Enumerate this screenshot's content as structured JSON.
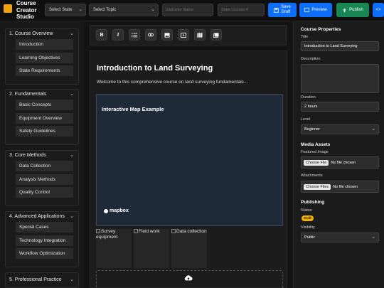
{
  "app": {
    "title_line1": "Course",
    "title_line2": "Creator",
    "title_line3": "Studio"
  },
  "topbar": {
    "state_select": "Select State",
    "topic_select": "Select Topic",
    "instructor_placeholder": "Instructor Name",
    "license_placeholder": "State License #",
    "save_label_line1": "Save",
    "save_label_line2": "Draft",
    "preview_label": "Preview",
    "publish_label": "Publish",
    "code_label": "<>"
  },
  "sidebar": {
    "sections": [
      {
        "title": "1. Course Overview",
        "items": [
          "Introduction",
          "Learning Objectives",
          "State Requirements"
        ]
      },
      {
        "title": "2. Fundamentals",
        "items": [
          "Basic Concepts",
          "Equipment Overview",
          "Safety Guidelines"
        ]
      },
      {
        "title": "3. Core Methods",
        "items": [
          "Data Collection",
          "Analysis Methods",
          "Quality Control"
        ]
      },
      {
        "title": "4. Advanced Applications",
        "items": [
          "Special Cases",
          "Technology Integration",
          "Workflow Optimization"
        ]
      },
      {
        "title": "5. Professional Practice",
        "items": []
      }
    ]
  },
  "editor": {
    "toolbar_icons": [
      "bold-icon",
      "italic-icon",
      "list-icon",
      "link-icon",
      "image-icon",
      "video-icon",
      "map-icon",
      "gallery-icon"
    ],
    "heading": "Introduction to Land Surveying",
    "intro": "Welcome to this comprehensive course on land surveying fundamentals...",
    "map_title": "Interactive Map Example",
    "map_logo": "mapbox",
    "images": [
      "Survey equipment",
      "Field work",
      "Data collection"
    ]
  },
  "properties": {
    "header": "Course Properties",
    "title_label": "Title",
    "title_value": "Introduction to Land Surveying",
    "description_label": "Description",
    "duration_label": "Duration",
    "duration_value": "2 hours",
    "level_label": "Level",
    "level_value": "Beginner",
    "media_header": "Media Assets",
    "featured_label": "Featured Image",
    "attachments_label": "Attachments",
    "choose_file": "Choose File",
    "no_file": "No file chosen",
    "choose_files": "Choose Files",
    "publishing_header": "Publishing",
    "status_label": "Status",
    "status_value": "Draft",
    "visibility_label": "Visibility",
    "visibility_value": "Public"
  },
  "colors": {
    "accent_blue": "#0d6efd",
    "accent_green": "#198754",
    "badge_yellow": "#f0b400",
    "logo_orange": "#f0a30a"
  }
}
